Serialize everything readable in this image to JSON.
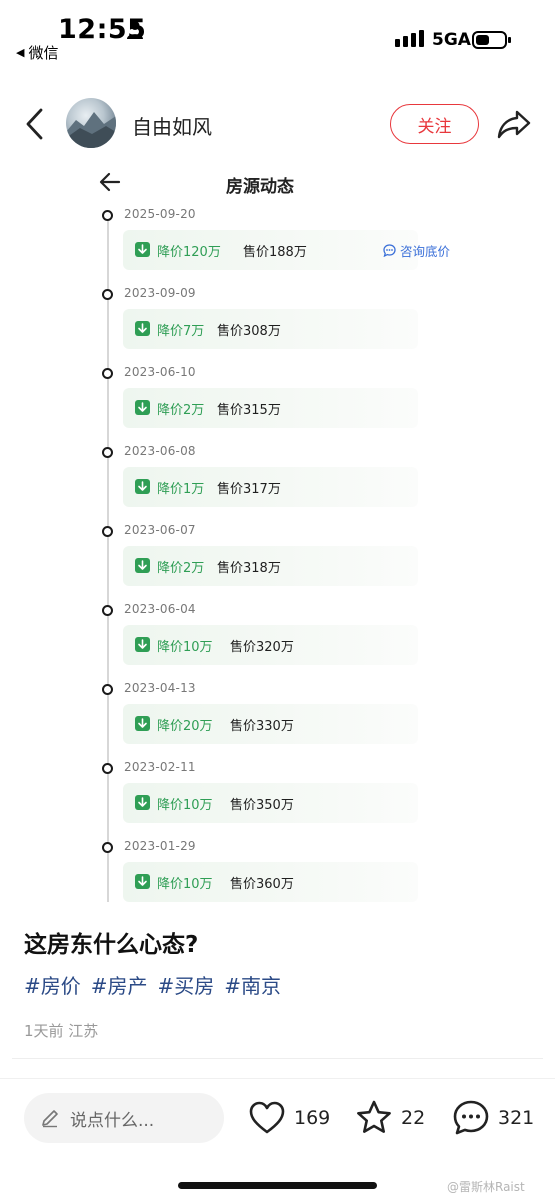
{
  "status_bar": {
    "time": "12:55",
    "back_app_label": "微信",
    "network": "5GA"
  },
  "header": {
    "author_name": "自由如风",
    "follow_label": "关注"
  },
  "listing": {
    "title": "房源动态",
    "consult_label": "咨询底价",
    "items": [
      {
        "date": "2025-09-20",
        "drop": "降价120万",
        "price": "售价188万"
      },
      {
        "date": "2023-09-09",
        "drop": "降价7万",
        "price": "售价308万"
      },
      {
        "date": "2023-06-10",
        "drop": "降价2万",
        "price": "售价315万"
      },
      {
        "date": "2023-06-08",
        "drop": "降价1万",
        "price": "售价317万"
      },
      {
        "date": "2023-06-07",
        "drop": "降价2万",
        "price": "售价318万"
      },
      {
        "date": "2023-06-04",
        "drop": "降价10万",
        "price": "售价320万"
      },
      {
        "date": "2023-04-13",
        "drop": "降价20万",
        "price": "售价330万"
      },
      {
        "date": "2023-02-11",
        "drop": "降价10万",
        "price": "售价350万"
      },
      {
        "date": "2023-01-29",
        "drop": "降价10万",
        "price": "售价360万"
      }
    ]
  },
  "post": {
    "title": "这房东什么心态?",
    "hashtags": [
      "#房价",
      "#房产",
      "#买房",
      "#南京"
    ],
    "meta": "1天前 江苏"
  },
  "bottom_bar": {
    "comment_placeholder": "说点什么...",
    "likes": "169",
    "collects": "22",
    "comments": "321"
  },
  "watermark": "@雷斯林Raist",
  "colors": {
    "accent_red": "#e8383d",
    "drop_green": "#2f9e55",
    "link_blue": "#3a6fd8",
    "hashtag_blue": "#2b4a86"
  },
  "icons": [
    "person-icon",
    "signal-icon",
    "battery-icon",
    "back-chevron-icon",
    "share-icon",
    "arrow-left-icon",
    "arrow-down-icon",
    "chat-bubble-icon",
    "pencil-icon",
    "heart-icon",
    "star-icon",
    "comment-icon"
  ]
}
